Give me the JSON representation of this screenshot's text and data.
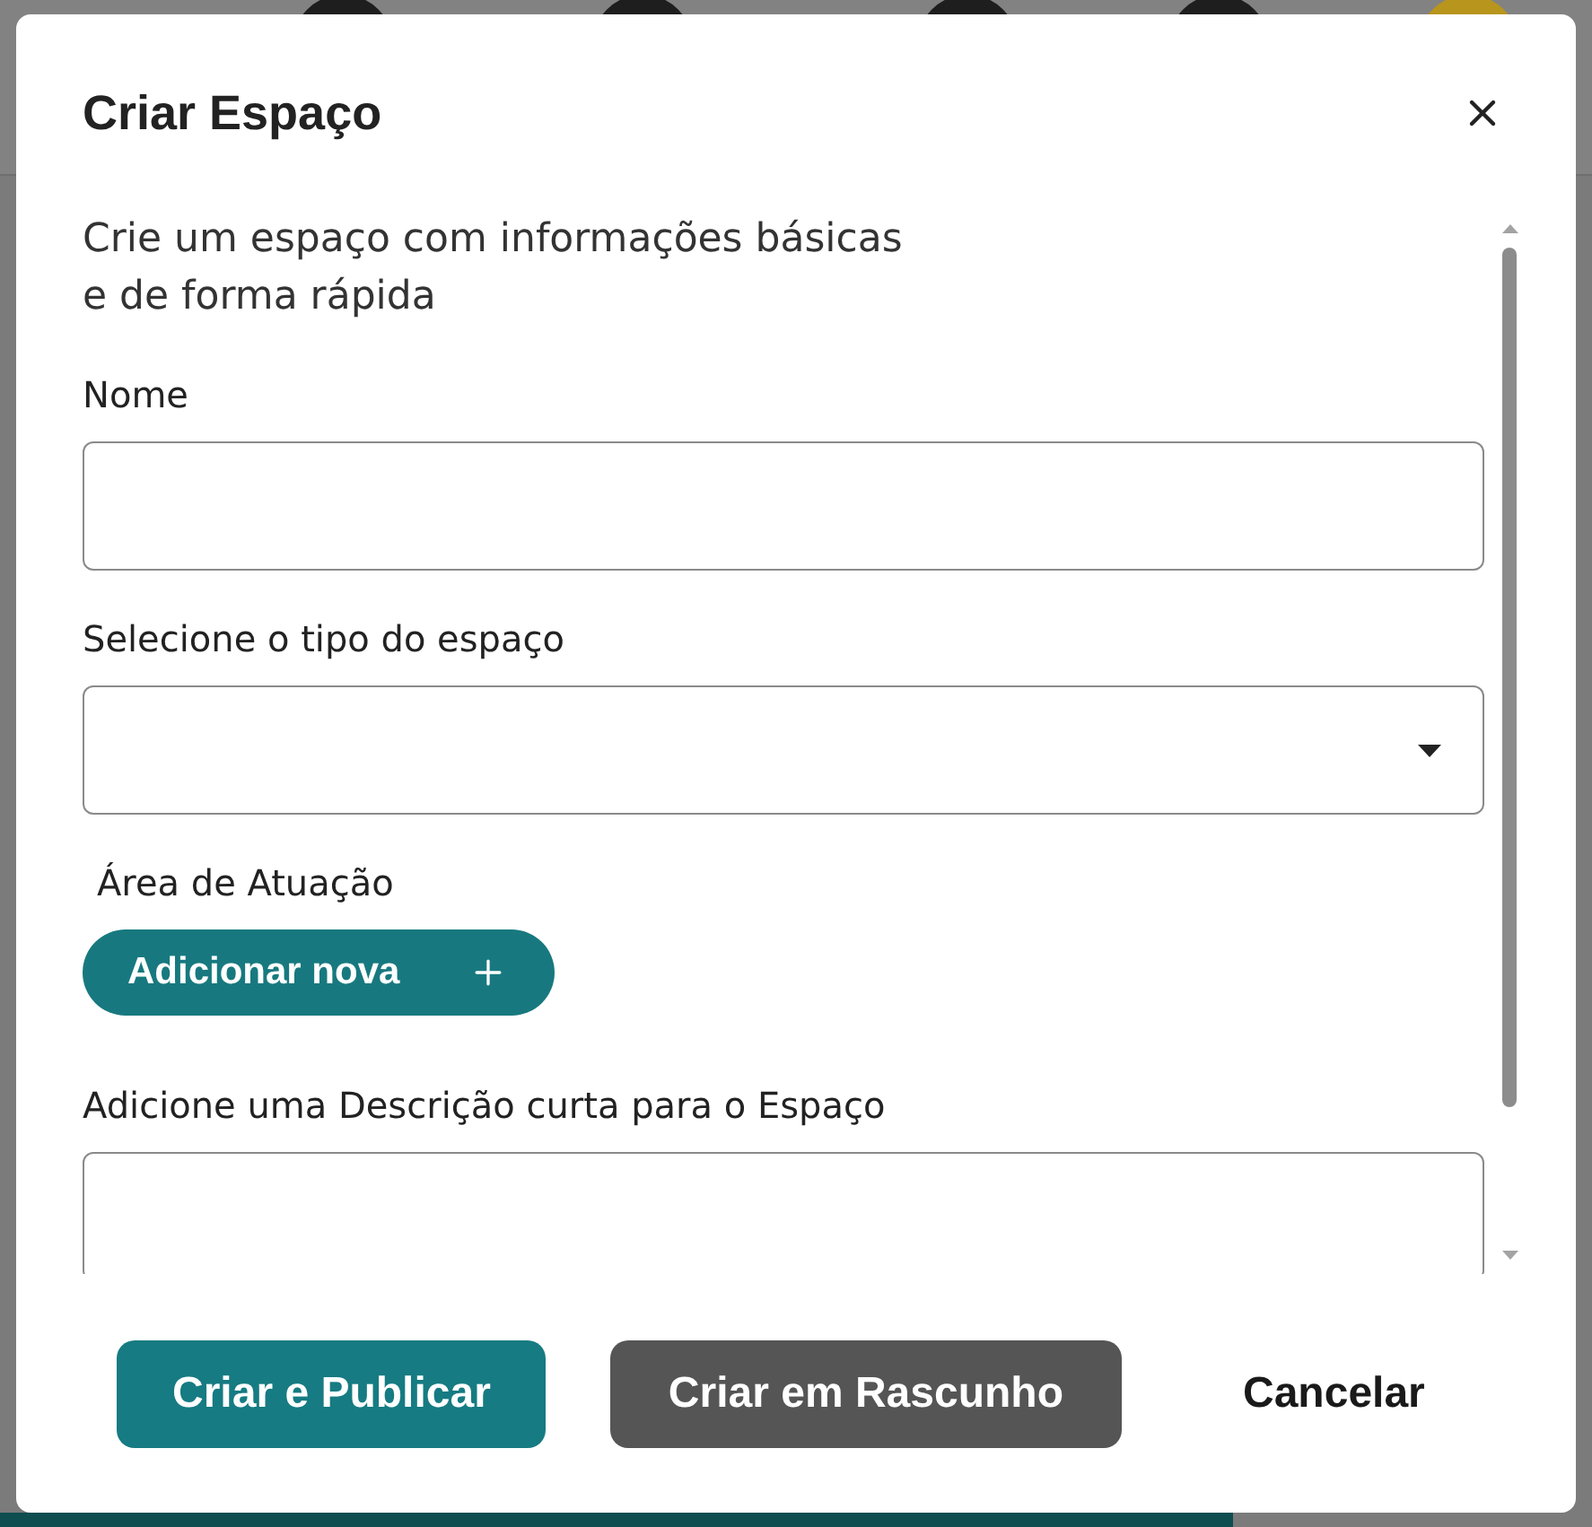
{
  "backdrop": {
    "nav_icons": [
      {
        "color": "#1e1e1e"
      },
      {
        "color": "#1e1e1e"
      },
      {
        "color": "#1e1e1e"
      },
      {
        "color": "#1e1e1e"
      },
      {
        "color": "#b8951c"
      }
    ]
  },
  "dialog": {
    "title": "Criar Espaço",
    "intro": "Crie um espaço com informações básicas e de forma rápida",
    "fields": [
      {
        "kind": "text",
        "label": "Nome"
      },
      {
        "kind": "select",
        "label": "Selecione o tipo do espaço"
      },
      {
        "kind": "tags",
        "label": "Área de Atuação",
        "button": "Adicionar nova"
      },
      {
        "kind": "textarea",
        "label": "Adicione uma Descrição curta para o Espaço"
      }
    ],
    "actions": [
      {
        "kind": "primary",
        "label": "Criar e Publicar"
      },
      {
        "kind": "secondary",
        "label": "Criar em Rascunho"
      },
      {
        "kind": "plain",
        "label": "Cancelar"
      }
    ]
  }
}
